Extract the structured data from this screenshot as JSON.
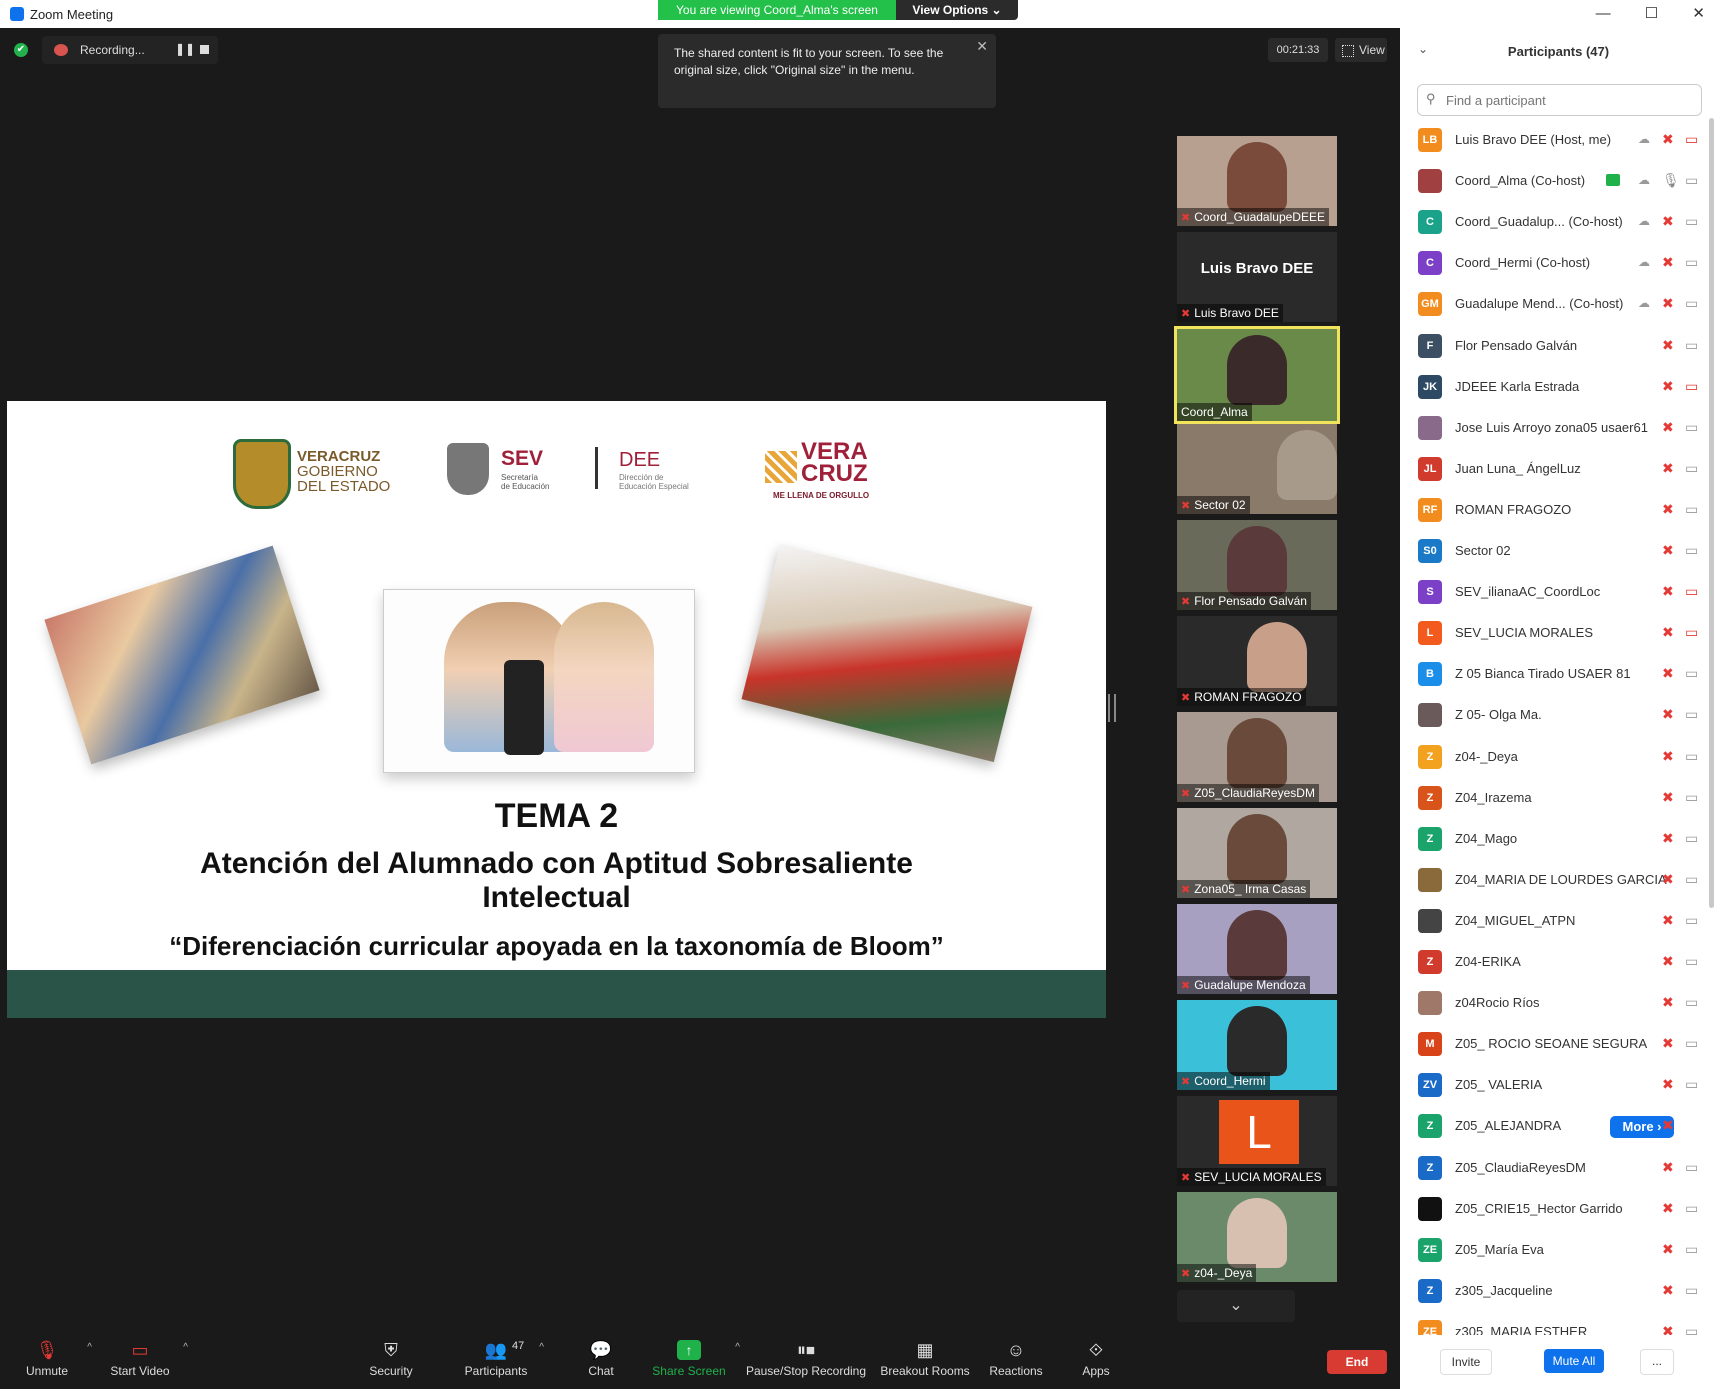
{
  "window": {
    "title": "Zoom Meeting"
  },
  "banner": {
    "viewing": "You are viewing Coord_Alma's screen",
    "view_options": "View Options ⌄"
  },
  "recording": {
    "label": "Recording..."
  },
  "timer": "00:21:33",
  "view_button": "View",
  "tooltip": {
    "text": "The shared content is fit to your screen. To see the original size, click \"Original size\" in the menu."
  },
  "slide": {
    "logos": {
      "veracruz_l1": "VERACRUZ",
      "veracruz_l2": "GOBIERNO",
      "veracruz_l3": "DEL ESTADO",
      "sev": "SEV",
      "sev_sub1": "Secretaría",
      "sev_sub2": "de Educación",
      "dee": "DEE",
      "dee_sub1": "Dirección de",
      "dee_sub2": "Educación Especial",
      "vc_l1": "VERA",
      "vc_l2": "CRUZ",
      "vc_sub": "ME LLENA DE ORGULLO"
    },
    "title": "TEMA 2",
    "subtitle_l1": "Atención del Alumnado con Aptitud Sobresaliente",
    "subtitle_l2": "Intelectual",
    "quote": "“Diferenciación curricular apoyada en la taxonomía de Bloom”"
  },
  "gallery": [
    {
      "name": "Coord_GuadalupeDEEE"
    },
    {
      "name": "Luis Bravo DEE",
      "big_name": "Luis Bravo DEE"
    },
    {
      "name": "Coord_Alma"
    },
    {
      "name": "Sector 02"
    },
    {
      "name": "Flor Pensado Galván"
    },
    {
      "name": "ROMAN FRAGOZO"
    },
    {
      "name": "Z05_ClaudiaReyesDM"
    },
    {
      "name": "Zona05_ Irma Casas"
    },
    {
      "name": "Guadalupe Mendoza"
    },
    {
      "name": "Coord_Hermi"
    },
    {
      "name": "SEV_LUCIA MORALES",
      "avatar_letter": "L"
    },
    {
      "name": "z04-_Deya"
    }
  ],
  "toolbar": {
    "unmute": "Unmute",
    "start_video": "Start Video",
    "security": "Security",
    "participants": "Participants",
    "participants_count": "47",
    "chat": "Chat",
    "share_screen": "Share Screen",
    "pause_stop": "Pause/Stop Recording",
    "breakout": "Breakout Rooms",
    "reactions": "Reactions",
    "apps": "Apps",
    "end": "End"
  },
  "panel": {
    "title": "Participants (47)",
    "search_placeholder": "Find a participant",
    "invite": "Invite",
    "mute_all": "Mute All",
    "more": "...",
    "more_button": "More ›",
    "participants": [
      {
        "initials": "LB",
        "color": "#f28c1e",
        "name": "Luis Bravo DEE (Host, me)"
      },
      {
        "initials": "",
        "color": "#a04040",
        "name": "Coord_Alma (Co-host)"
      },
      {
        "initials": "C",
        "color": "#1aa38a",
        "name": "Coord_Guadalup...  (Co-host)"
      },
      {
        "initials": "C",
        "color": "#7b3fc8",
        "name": "Coord_Hermi (Co-host)"
      },
      {
        "initials": "GM",
        "color": "#f28c1e",
        "name": "Guadalupe Mend...  (Co-host)"
      },
      {
        "initials": "F",
        "color": "#3d4f63",
        "name": "Flor Pensado Galván"
      },
      {
        "initials": "JK",
        "color": "#2d4963",
        "name": "JDEEE Karla Estrada"
      },
      {
        "initials": "",
        "color": "#8a6a8a",
        "name": "Jose Luis Arroyo zona05 usaer61"
      },
      {
        "initials": "JL",
        "color": "#d13b2e",
        "name": "Juan Luna_ ÁngelLuz"
      },
      {
        "initials": "RF",
        "color": "#f28c1e",
        "name": "ROMAN FRAGOZO"
      },
      {
        "initials": "S0",
        "color": "#1a7ac8",
        "name": "Sector 02"
      },
      {
        "initials": "S",
        "color": "#7b3fc8",
        "name": "SEV_ilianaAC_CoordLoc"
      },
      {
        "initials": "L",
        "color": "#f25a1e",
        "name": "SEV_LUCIA MORALES"
      },
      {
        "initials": "B",
        "color": "#1a8ee8",
        "name": "Z 05 Bianca Tirado USAER 81"
      },
      {
        "initials": "",
        "color": "#6a5a5a",
        "name": "Z 05- Olga Ma."
      },
      {
        "initials": "Z",
        "color": "#f2a21e",
        "name": "z04-_Deya"
      },
      {
        "initials": "Z",
        "color": "#d9541a",
        "name": "Z04_Irazema"
      },
      {
        "initials": "Z",
        "color": "#1aa36a",
        "name": "Z04_Mago"
      },
      {
        "initials": "",
        "color": "#8a6a3a",
        "name": "Z04_MARIA DE LOURDES GARCIA"
      },
      {
        "initials": "",
        "color": "#444444",
        "name": "Z04_MIGUEL_ATPN"
      },
      {
        "initials": "Z",
        "color": "#d13b2e",
        "name": "Z04-ERIKA"
      },
      {
        "initials": "",
        "color": "#a0786a",
        "name": "z04Rocio Ríos"
      },
      {
        "initials": "M",
        "color": "#d9431a",
        "name": "Z05_ ROCIO SEOANE SEGURA"
      },
      {
        "initials": "ZV",
        "color": "#1a6ac8",
        "name": "Z05_ VALERIA"
      },
      {
        "initials": "Z",
        "color": "#1aa36a",
        "name": "Z05_ALEJANDRA"
      },
      {
        "initials": "Z",
        "color": "#1a6ac8",
        "name": "Z05_ClaudiaReyesDM"
      },
      {
        "initials": "",
        "color": "#111111",
        "name": "Z05_CRIE15_Hector Garrido"
      },
      {
        "initials": "ZE",
        "color": "#1aa36a",
        "name": "Z05_María Eva"
      },
      {
        "initials": "Z",
        "color": "#1a6ac8",
        "name": "z305_Jacqueline"
      },
      {
        "initials": "ZE",
        "color": "#f28c1e",
        "name": "z305_MARIA ESTHER"
      }
    ]
  }
}
